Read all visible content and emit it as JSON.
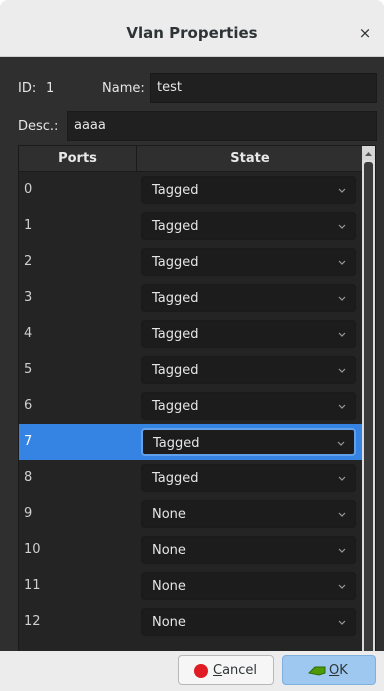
{
  "window": {
    "title": "Vlan Properties",
    "close_glyph": "×"
  },
  "form": {
    "id_label": "ID:",
    "id_value": "1",
    "name_label": "Name:",
    "name_value": "test",
    "desc_label": "Desc.:",
    "desc_value": "aaaa"
  },
  "table": {
    "headers": [
      "Ports",
      "State"
    ],
    "selected_port": "7",
    "rows": [
      {
        "port": "0",
        "state": "Tagged"
      },
      {
        "port": "1",
        "state": "Tagged"
      },
      {
        "port": "2",
        "state": "Tagged"
      },
      {
        "port": "3",
        "state": "Tagged"
      },
      {
        "port": "4",
        "state": "Tagged"
      },
      {
        "port": "5",
        "state": "Tagged"
      },
      {
        "port": "6",
        "state": "Tagged"
      },
      {
        "port": "7",
        "state": "Tagged"
      },
      {
        "port": "8",
        "state": "Tagged"
      },
      {
        "port": "9",
        "state": "None"
      },
      {
        "port": "10",
        "state": "None"
      },
      {
        "port": "11",
        "state": "None"
      },
      {
        "port": "12",
        "state": "None"
      }
    ]
  },
  "buttons": {
    "cancel_mnemonic": "C",
    "cancel_rest": "ancel",
    "ok_mnemonic": "O",
    "ok_rest": "K"
  },
  "colors": {
    "selection": "#3584e4",
    "focus_border": "#62a0ea",
    "cancel_icon": "#e01b24",
    "ok_icon": "#4e9a06"
  }
}
